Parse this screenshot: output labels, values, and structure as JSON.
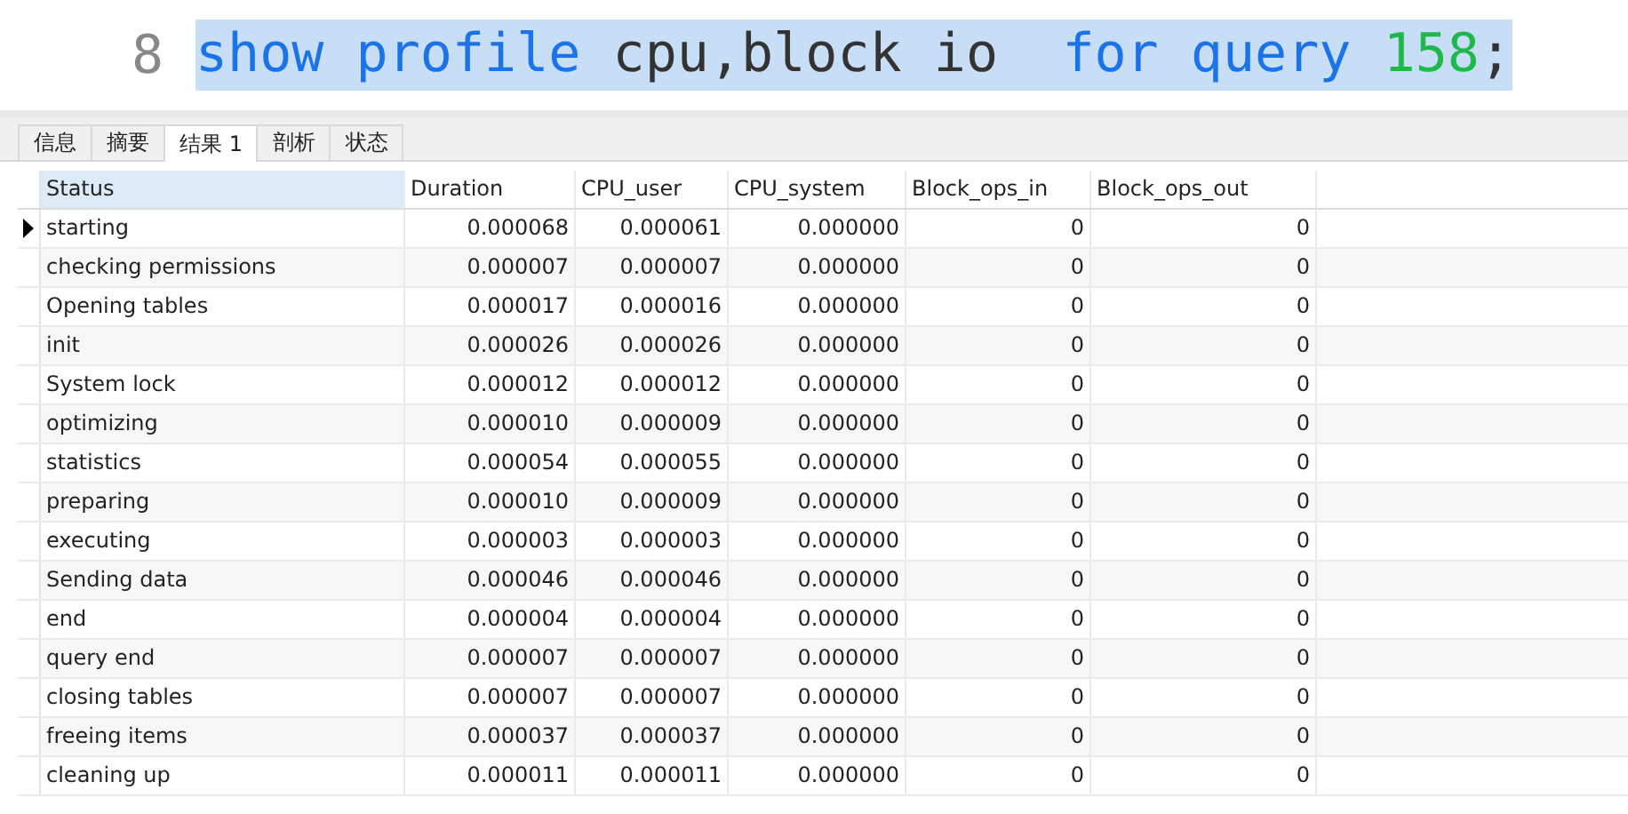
{
  "editor": {
    "line_number": "8",
    "selected": true,
    "tokens": [
      {
        "kind": "keyword",
        "text": "show profile"
      },
      {
        "kind": "plain",
        "text": " cpu,block io  "
      },
      {
        "kind": "keyword",
        "text": "for query "
      },
      {
        "kind": "number",
        "text": "158"
      },
      {
        "kind": "plain",
        "text": ";"
      }
    ]
  },
  "tabs": [
    {
      "label": "信息",
      "selected": false
    },
    {
      "label": "摘要",
      "selected": false
    },
    {
      "label": "结果 1",
      "selected": true
    },
    {
      "label": "剖析",
      "selected": false
    },
    {
      "label": "状态",
      "selected": false
    }
  ],
  "table": {
    "columns": [
      {
        "label": "Status",
        "selected": true
      },
      {
        "label": "Duration",
        "selected": false
      },
      {
        "label": "CPU_user",
        "selected": false
      },
      {
        "label": "CPU_system",
        "selected": false
      },
      {
        "label": "Block_ops_in",
        "selected": false
      },
      {
        "label": "Block_ops_out",
        "selected": false
      }
    ],
    "rows": [
      {
        "selected": true,
        "cells": [
          "starting",
          "0.000068",
          "0.000061",
          "0.000000",
          "0",
          "0"
        ]
      },
      {
        "selected": false,
        "cells": [
          "checking permissions",
          "0.000007",
          "0.000007",
          "0.000000",
          "0",
          "0"
        ]
      },
      {
        "selected": false,
        "cells": [
          "Opening tables",
          "0.000017",
          "0.000016",
          "0.000000",
          "0",
          "0"
        ]
      },
      {
        "selected": false,
        "cells": [
          "init",
          "0.000026",
          "0.000026",
          "0.000000",
          "0",
          "0"
        ]
      },
      {
        "selected": false,
        "cells": [
          "System lock",
          "0.000012",
          "0.000012",
          "0.000000",
          "0",
          "0"
        ]
      },
      {
        "selected": false,
        "cells": [
          "optimizing",
          "0.000010",
          "0.000009",
          "0.000000",
          "0",
          "0"
        ]
      },
      {
        "selected": false,
        "cells": [
          "statistics",
          "0.000054",
          "0.000055",
          "0.000000",
          "0",
          "0"
        ]
      },
      {
        "selected": false,
        "cells": [
          "preparing",
          "0.000010",
          "0.000009",
          "0.000000",
          "0",
          "0"
        ]
      },
      {
        "selected": false,
        "cells": [
          "executing",
          "0.000003",
          "0.000003",
          "0.000000",
          "0",
          "0"
        ]
      },
      {
        "selected": false,
        "cells": [
          "Sending data",
          "0.000046",
          "0.000046",
          "0.000000",
          "0",
          "0"
        ]
      },
      {
        "selected": false,
        "cells": [
          "end",
          "0.000004",
          "0.000004",
          "0.000000",
          "0",
          "0"
        ]
      },
      {
        "selected": false,
        "cells": [
          "query end",
          "0.000007",
          "0.000007",
          "0.000000",
          "0",
          "0"
        ]
      },
      {
        "selected": false,
        "cells": [
          "closing tables",
          "0.000007",
          "0.000007",
          "0.000000",
          "0",
          "0"
        ]
      },
      {
        "selected": false,
        "cells": [
          "freeing items",
          "0.000037",
          "0.000037",
          "0.000000",
          "0",
          "0"
        ]
      },
      {
        "selected": false,
        "cells": [
          "cleaning up",
          "0.000011",
          "0.000011",
          "0.000000",
          "0",
          "0"
        ]
      }
    ]
  }
}
